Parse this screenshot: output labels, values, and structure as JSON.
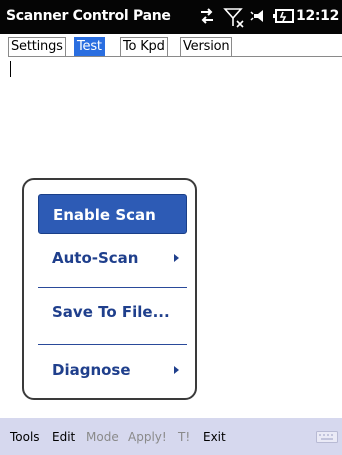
{
  "title_bar": {
    "title": "Scanner Control Pane",
    "clock": "12:12"
  },
  "tabs": [
    {
      "label": "Settings",
      "active": false
    },
    {
      "label": "Test",
      "active": true
    },
    {
      "label": "To Kpd",
      "active": false
    },
    {
      "label": "Version",
      "active": false
    }
  ],
  "menu": {
    "items": [
      {
        "label": "Enable Scan",
        "highlighted": true,
        "has_submenu": false
      },
      {
        "label": "Auto-Scan",
        "highlighted": false,
        "has_submenu": true
      },
      {
        "label": "Save To File...",
        "highlighted": false,
        "has_submenu": false
      },
      {
        "label": "Diagnose",
        "highlighted": false,
        "has_submenu": true
      }
    ]
  },
  "menubar": {
    "tools": "Tools",
    "edit": "Edit",
    "mode": "Mode",
    "apply": "Apply!",
    "t": "T!",
    "exit": "Exit"
  },
  "colors": {
    "accent": "#2a6ee0",
    "menu_highlight": "#2d5bb5",
    "menu_text": "#1f3f8c",
    "menubar_bg": "#d6d8ee"
  },
  "icons": {
    "status": [
      "sync-icon",
      "no-signal-icon",
      "speaker-icon",
      "battery-icon"
    ],
    "menubar": "keyboard-icon"
  }
}
